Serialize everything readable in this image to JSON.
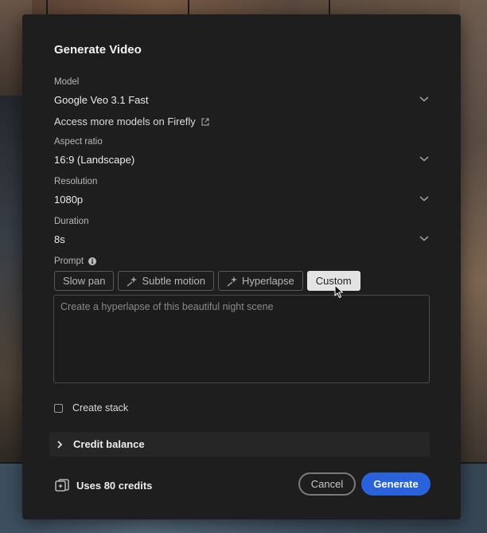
{
  "dialog": {
    "title": "Generate Video",
    "model": {
      "label": "Model",
      "value": "Google Veo 3.1 Fast"
    },
    "more_models_link": "Access more models on Firefly",
    "aspect_ratio": {
      "label": "Aspect ratio",
      "value": "16:9 (Landscape)"
    },
    "resolution": {
      "label": "Resolution",
      "value": "1080p"
    },
    "duration": {
      "label": "Duration",
      "value": "8s"
    },
    "prompt": {
      "label": "Prompt",
      "presets": [
        "Slow pan",
        "Subtle motion",
        "Hyperlapse",
        "Custom"
      ],
      "selected_preset": "Custom",
      "text": "Create a hyperlapse of this beautiful night scene"
    },
    "create_stack": {
      "label": "Create stack",
      "checked": false
    },
    "credit_balance": {
      "label": "Credit balance",
      "expanded": false
    },
    "credits_usage": "Uses 80 credits",
    "buttons": {
      "cancel": "Cancel",
      "generate": "Generate"
    }
  },
  "colors": {
    "dialog_bg": "#1e1e1e",
    "accent": "#2a62dc",
    "chip_active_bg": "#e3e3e3"
  },
  "icons": {
    "dropdown": "chevron-down-icon",
    "external": "external-link-icon",
    "info": "info-icon",
    "sparkle": "sparkle-icon",
    "expand": "chevron-right-icon",
    "credits": "credits-icon",
    "cursor": "mouse-pointer-icon"
  }
}
